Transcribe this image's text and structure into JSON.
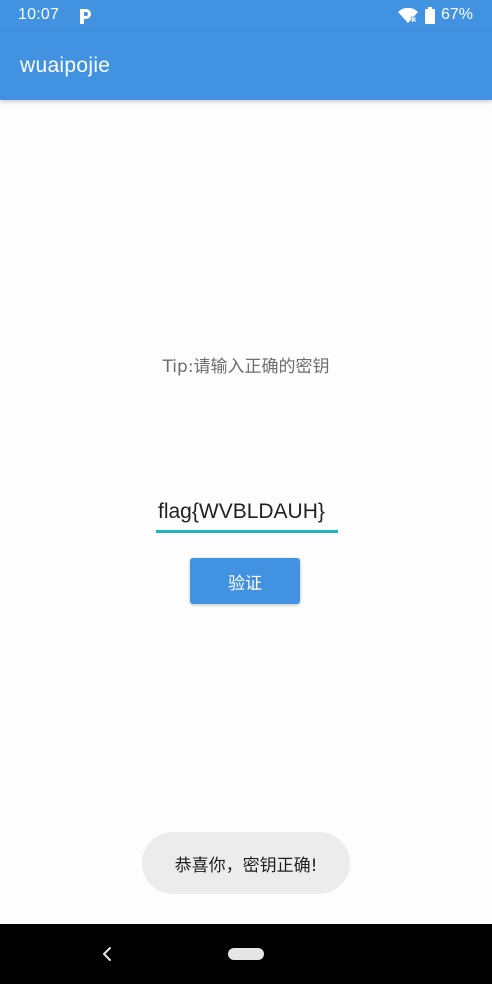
{
  "status_bar": {
    "time": "10:07",
    "battery_percent": "67%",
    "icons": [
      "pocket-casts-notification-icon",
      "wifi-no-internet-icon",
      "battery-icon"
    ]
  },
  "app_bar": {
    "title": "wuaipojie",
    "color": "#4193e2"
  },
  "main": {
    "tip": "Tip:请输入正确的密钥",
    "key_input_value": "flag{WVBLDAUH}",
    "verify_button_label": "验证",
    "accent_underline_color": "#1fb4bd"
  },
  "toast": {
    "message": "恭喜你，密钥正确!"
  },
  "nav_bar": {
    "icons": [
      "back-icon",
      "home-pill-icon"
    ]
  }
}
